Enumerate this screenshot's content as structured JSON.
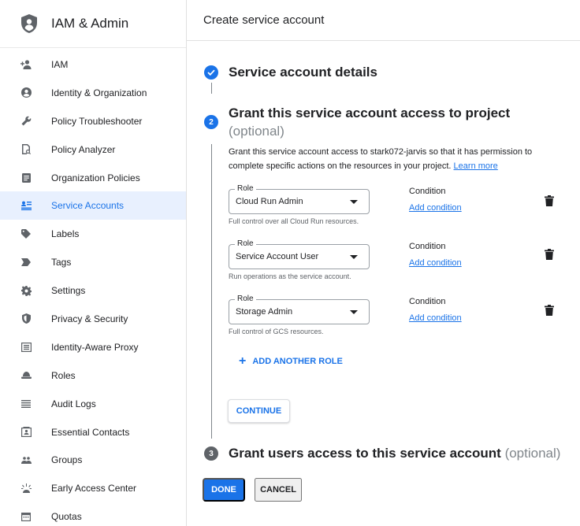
{
  "app": {
    "title": "IAM & Admin"
  },
  "sidebar": {
    "items": [
      {
        "label": "IAM",
        "icon": "person-add-icon"
      },
      {
        "label": "Identity & Organization",
        "icon": "account-circle-icon"
      },
      {
        "label": "Policy Troubleshooter",
        "icon": "wrench-icon"
      },
      {
        "label": "Policy Analyzer",
        "icon": "document-search-icon"
      },
      {
        "label": "Organization Policies",
        "icon": "list-doc-icon"
      },
      {
        "label": "Service Accounts",
        "icon": "service-account-icon",
        "active": true
      },
      {
        "label": "Labels",
        "icon": "label-icon"
      },
      {
        "label": "Tags",
        "icon": "tag-arrow-icon"
      },
      {
        "label": "Settings",
        "icon": "gear-icon"
      },
      {
        "label": "Privacy & Security",
        "icon": "shield-icon"
      },
      {
        "label": "Identity-Aware Proxy",
        "icon": "proxy-icon"
      },
      {
        "label": "Roles",
        "icon": "hat-icon"
      },
      {
        "label": "Audit Logs",
        "icon": "lines-icon"
      },
      {
        "label": "Essential Contacts",
        "icon": "contact-card-icon"
      },
      {
        "label": "Groups",
        "icon": "group-icon"
      },
      {
        "label": "Early Access Center",
        "icon": "sparkle-icon"
      },
      {
        "label": "Quotas",
        "icon": "calendar-icon"
      }
    ]
  },
  "main": {
    "page_title": "Create service account",
    "step1": {
      "title": "Service account details"
    },
    "step2": {
      "number": "2",
      "title": "Grant this service account access to project",
      "optional": "(optional)",
      "description": "Grant this service account access to stark072-jarvis so that it has permission to complete specific actions on the resources in your project.",
      "learn_more": "Learn more",
      "roles": [
        {
          "legend": "Role",
          "value": "Cloud Run Admin",
          "helper": "Full control over all Cloud Run resources.",
          "condition_label": "Condition",
          "condition_link": "Add condition"
        },
        {
          "legend": "Role",
          "value": "Service Account User",
          "helper": "Run operations as the service account.",
          "condition_label": "Condition",
          "condition_link": "Add condition"
        },
        {
          "legend": "Role",
          "value": "Storage Admin",
          "helper": "Full control of GCS resources.",
          "condition_label": "Condition",
          "condition_link": "Add condition"
        }
      ],
      "add_role": "ADD ANOTHER ROLE",
      "continue": "CONTINUE"
    },
    "step3": {
      "number": "3",
      "title": "Grant users access to this service account",
      "optional": "(optional)"
    },
    "done": "DONE",
    "cancel": "CANCEL"
  },
  "colors": {
    "accent": "#1a73e8",
    "active_bg": "#e8f0fe",
    "step_done": "#1a73e8",
    "step_pending": "#5f6368"
  }
}
